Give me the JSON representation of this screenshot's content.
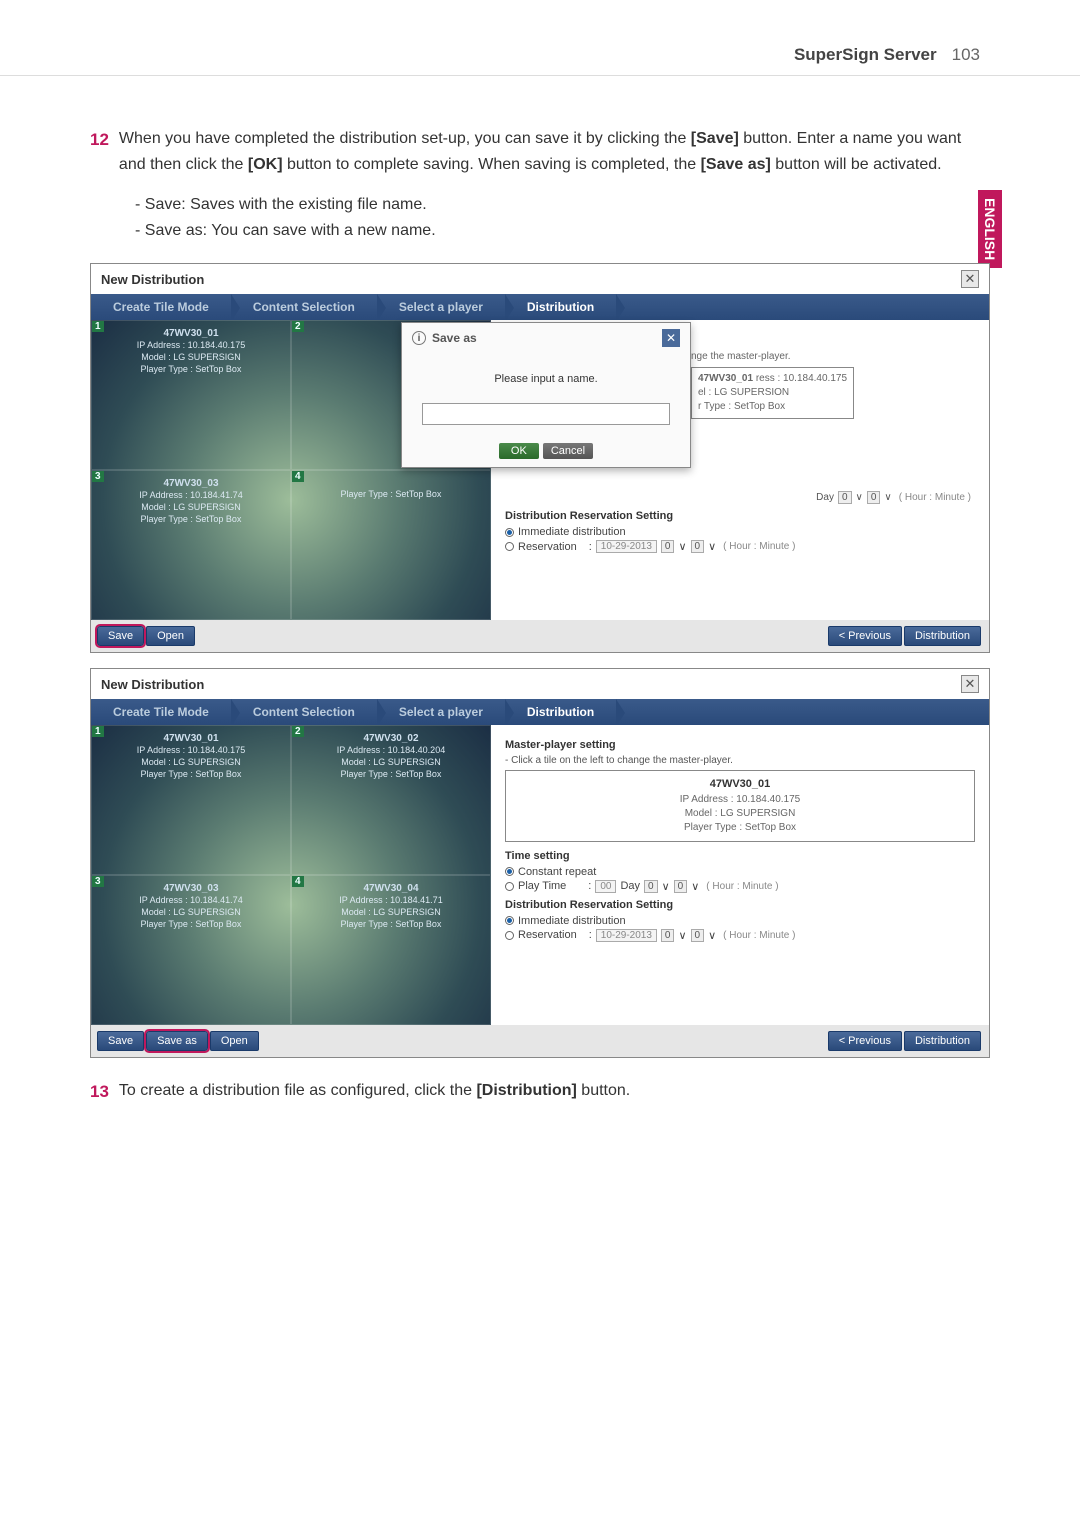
{
  "header": {
    "title": "SuperSign Server",
    "page": "103"
  },
  "side_tab": "ENGLISH",
  "step12": {
    "num": "12",
    "text": "When you have completed the distribution set-up, you can save it by clicking the [Save] button. Enter a name you want and then click the [OK] button to complete saving. When saving is completed, the [Save as] button will be activated.",
    "bullets": [
      "Save: Saves with the existing file name.",
      "Save as: You can save with a new name."
    ]
  },
  "step13": {
    "num": "13",
    "text": "To create a distribution file as configured, click the [Distribution] button."
  },
  "wizard": {
    "s1": "Create Tile Mode",
    "s2": "Content Selection",
    "s3": "Select a player",
    "s4": "Distribution"
  },
  "app": {
    "title": "New Distribution"
  },
  "tiles": {
    "t1_name": "47WV30_01",
    "t1_ip": "IP Address : 10.184.40.175",
    "t1_model": "Model : LG SUPERSIGN",
    "t1_ptype": "Player Type : SetTop Box",
    "t2_name": "47WV30_02",
    "t2_ip": "IP Address : 10.184.40.204",
    "t3_name": "47WV30_03",
    "t3_ip": "IP Address : 10.184.41.74",
    "t4_name": "47WV30_04",
    "t4_ip": "IP Address : 10.184.41.71"
  },
  "dialog": {
    "title": "Save as",
    "msg": "Please input a name.",
    "ok": "OK",
    "cancel": "Cancel"
  },
  "right": {
    "master_head": "Master-player setting",
    "master_hint": "- Click a tile on the left to change the master-player.",
    "frag_hint": "nge the master-player.",
    "mb_name": "47WV30_01",
    "mb_ip": "IP Address : 10.184.40.175",
    "mb_model": "Model : LG SUPERSIGN",
    "mb_ptype": "Player Type : SetTop Box",
    "frag_ip": "ress : 10.184.40.175",
    "frag_model": "el : LG SUPERSION",
    "frag_ptype": "r Type : SetTop Box",
    "time_head": "Time setting",
    "constant": "Constant repeat",
    "playtime": "Play Time",
    "playtime_val": "00",
    "day": "Day",
    "hh": "0",
    "mm": "0",
    "hourmin": "( Hour : Minute )",
    "dist_head": "Distribution Reservation Setting",
    "immediate": "Immediate distribution",
    "reservation": "Reservation",
    "date": "10-29-2013"
  },
  "footer": {
    "save": "Save",
    "saveas": "Save as",
    "open": "Open",
    "prev": "< Previous",
    "dist": "Distribution"
  }
}
